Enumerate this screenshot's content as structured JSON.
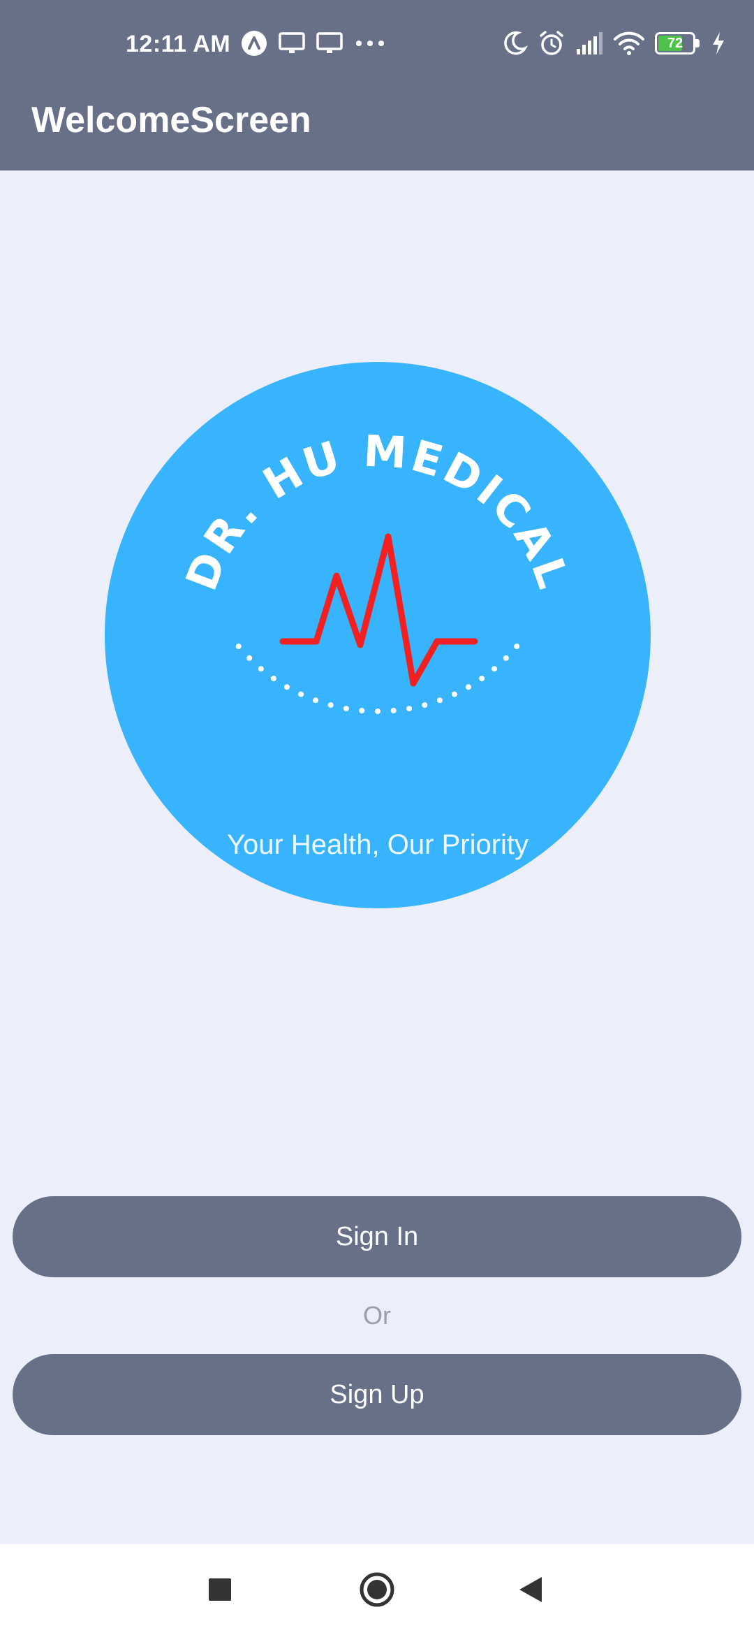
{
  "status_bar": {
    "time": "12:11 AM",
    "battery": "72",
    "left_icons": [
      "assistant-icon",
      "cast-icon",
      "cast-icon-2",
      "more-dots-icon"
    ],
    "right_icons": [
      "moon-icon",
      "alarm-icon",
      "signal-icon",
      "wifi-icon",
      "battery-icon",
      "charging-icon"
    ]
  },
  "app_bar": {
    "title": "WelcomeScreen"
  },
  "logo": {
    "brand": "DR. HU MEDICAL",
    "tagline": "Your Health, Our Priority",
    "circle_color": "#38b3fd",
    "pulse_color": "#f22020"
  },
  "actions": {
    "sign_in": "Sign In",
    "or": "Or",
    "sign_up": "Sign Up"
  },
  "colors": {
    "primary": "#687087",
    "background": "#eceff9"
  },
  "nav_bar": {
    "icons": [
      "recents-square-icon",
      "home-circle-icon",
      "back-triangle-icon"
    ]
  }
}
